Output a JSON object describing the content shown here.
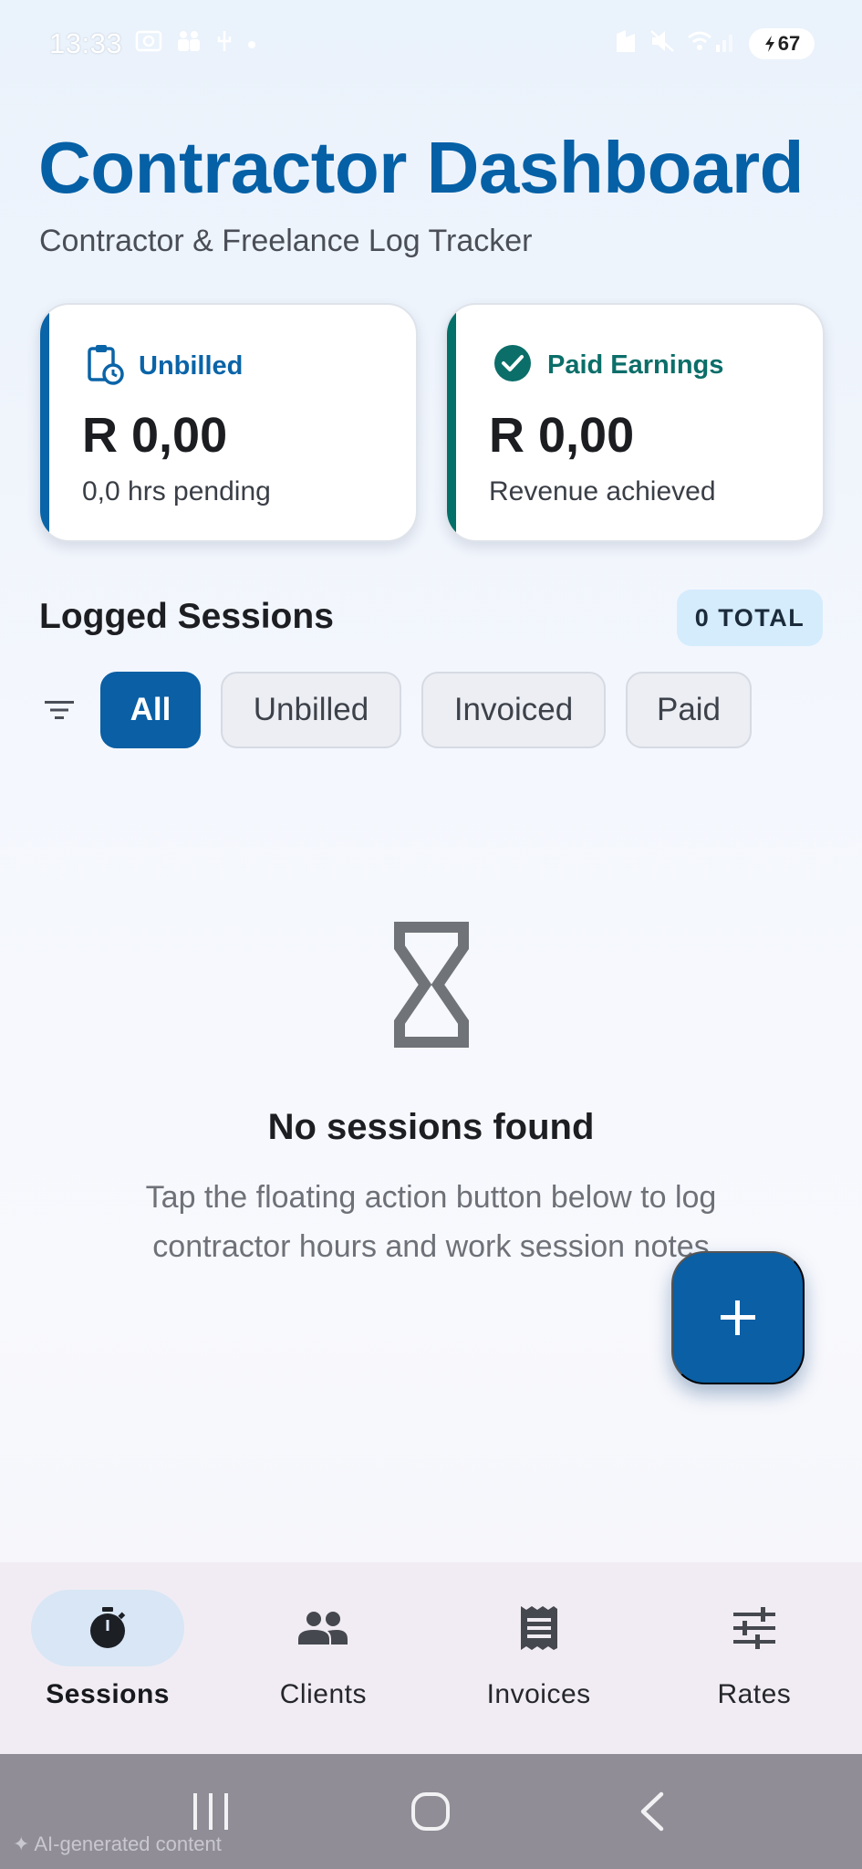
{
  "status_bar": {
    "time": "13:33",
    "battery": "67"
  },
  "header": {
    "title": "Contractor Dashboard",
    "subtitle": "Contractor & Freelance Log Tracker"
  },
  "cards": [
    {
      "label": "Unbilled",
      "amount": "R 0,00",
      "sub": "0,0 hrs pending",
      "icon": "clipboard-clock-icon",
      "accent": "#0a64a8"
    },
    {
      "label": "Paid Earnings",
      "amount": "R 0,00",
      "sub": "Revenue achieved",
      "icon": "check-circle-icon",
      "accent": "#04706a"
    }
  ],
  "sessions": {
    "title": "Logged Sessions",
    "total_badge": "0 TOTAL",
    "filters": [
      "All",
      "Unbilled",
      "Invoiced",
      "Paid"
    ],
    "active_filter": "All"
  },
  "empty_state": {
    "icon": "hourglass-icon",
    "title": "No sessions found",
    "text": "Tap the floating action button below to log contractor hours and work session notes"
  },
  "fab": {
    "label": "+",
    "icon": "plus-icon"
  },
  "bottom_nav": {
    "items": [
      {
        "label": "Sessions",
        "icon": "stopwatch-icon",
        "active": true
      },
      {
        "label": "Clients",
        "icon": "people-icon",
        "active": false
      },
      {
        "label": "Invoices",
        "icon": "receipt-icon",
        "active": false
      },
      {
        "label": "Rates",
        "icon": "sliders-icon",
        "active": false
      }
    ]
  },
  "system_nav": {
    "ai_note": "AI-generated content"
  },
  "colors": {
    "primary": "#0a5fa5",
    "teal": "#04706a",
    "badge_bg": "#d5ecfc"
  }
}
